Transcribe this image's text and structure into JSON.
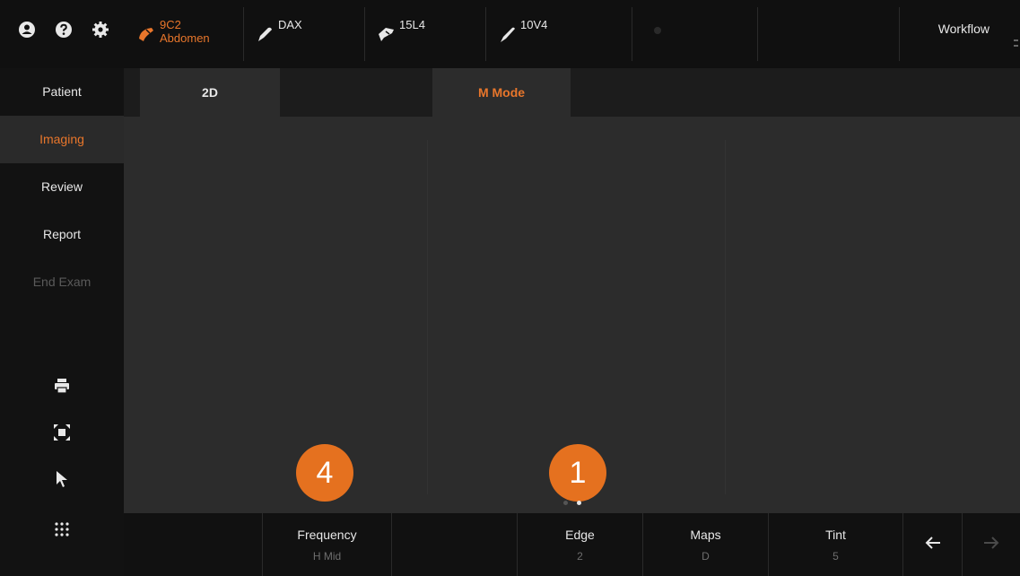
{
  "top_icons": [
    "user-icon",
    "help-icon",
    "settings-icon"
  ],
  "probes": [
    {
      "line1": "9C2",
      "line2": "Abdomen",
      "icon": "curved-probe-icon",
      "active": true
    },
    {
      "line1": "DAX",
      "line2": "",
      "icon": "pencil-probe-icon",
      "active": false
    },
    {
      "line1": "15L4",
      "line2": "",
      "icon": "linear-probe-icon",
      "active": false
    },
    {
      "line1": "10V4",
      "line2": "",
      "icon": "vector-probe-icon",
      "active": false
    }
  ],
  "workflow_label": "Workflow",
  "sidebar": {
    "items": [
      {
        "label": "Patient",
        "state": "normal"
      },
      {
        "label": "Imaging",
        "state": "active"
      },
      {
        "label": "Review",
        "state": "normal"
      },
      {
        "label": "Report",
        "state": "normal"
      },
      {
        "label": "End Exam",
        "state": "disabled"
      }
    ],
    "tools": [
      "print-icon",
      "fullscreen-icon",
      "pointer-icon"
    ],
    "grid_icon": "grid-icon"
  },
  "tabs": [
    {
      "label": "2D",
      "active": false
    },
    {
      "label": "M Mode",
      "active": true
    }
  ],
  "badges": {
    "left": "4",
    "right": "1"
  },
  "page_dots": {
    "count": 2,
    "current": 2
  },
  "bottom_controls": {
    "frequency": {
      "label": "Frequency",
      "value": "H Mid"
    },
    "edge": {
      "label": "Edge",
      "value": "2"
    },
    "maps": {
      "label": "Maps",
      "value": "D"
    },
    "tint": {
      "label": "Tint",
      "value": "5"
    }
  },
  "colors": {
    "accent": "#e8762b",
    "badge": "#e5711f"
  }
}
